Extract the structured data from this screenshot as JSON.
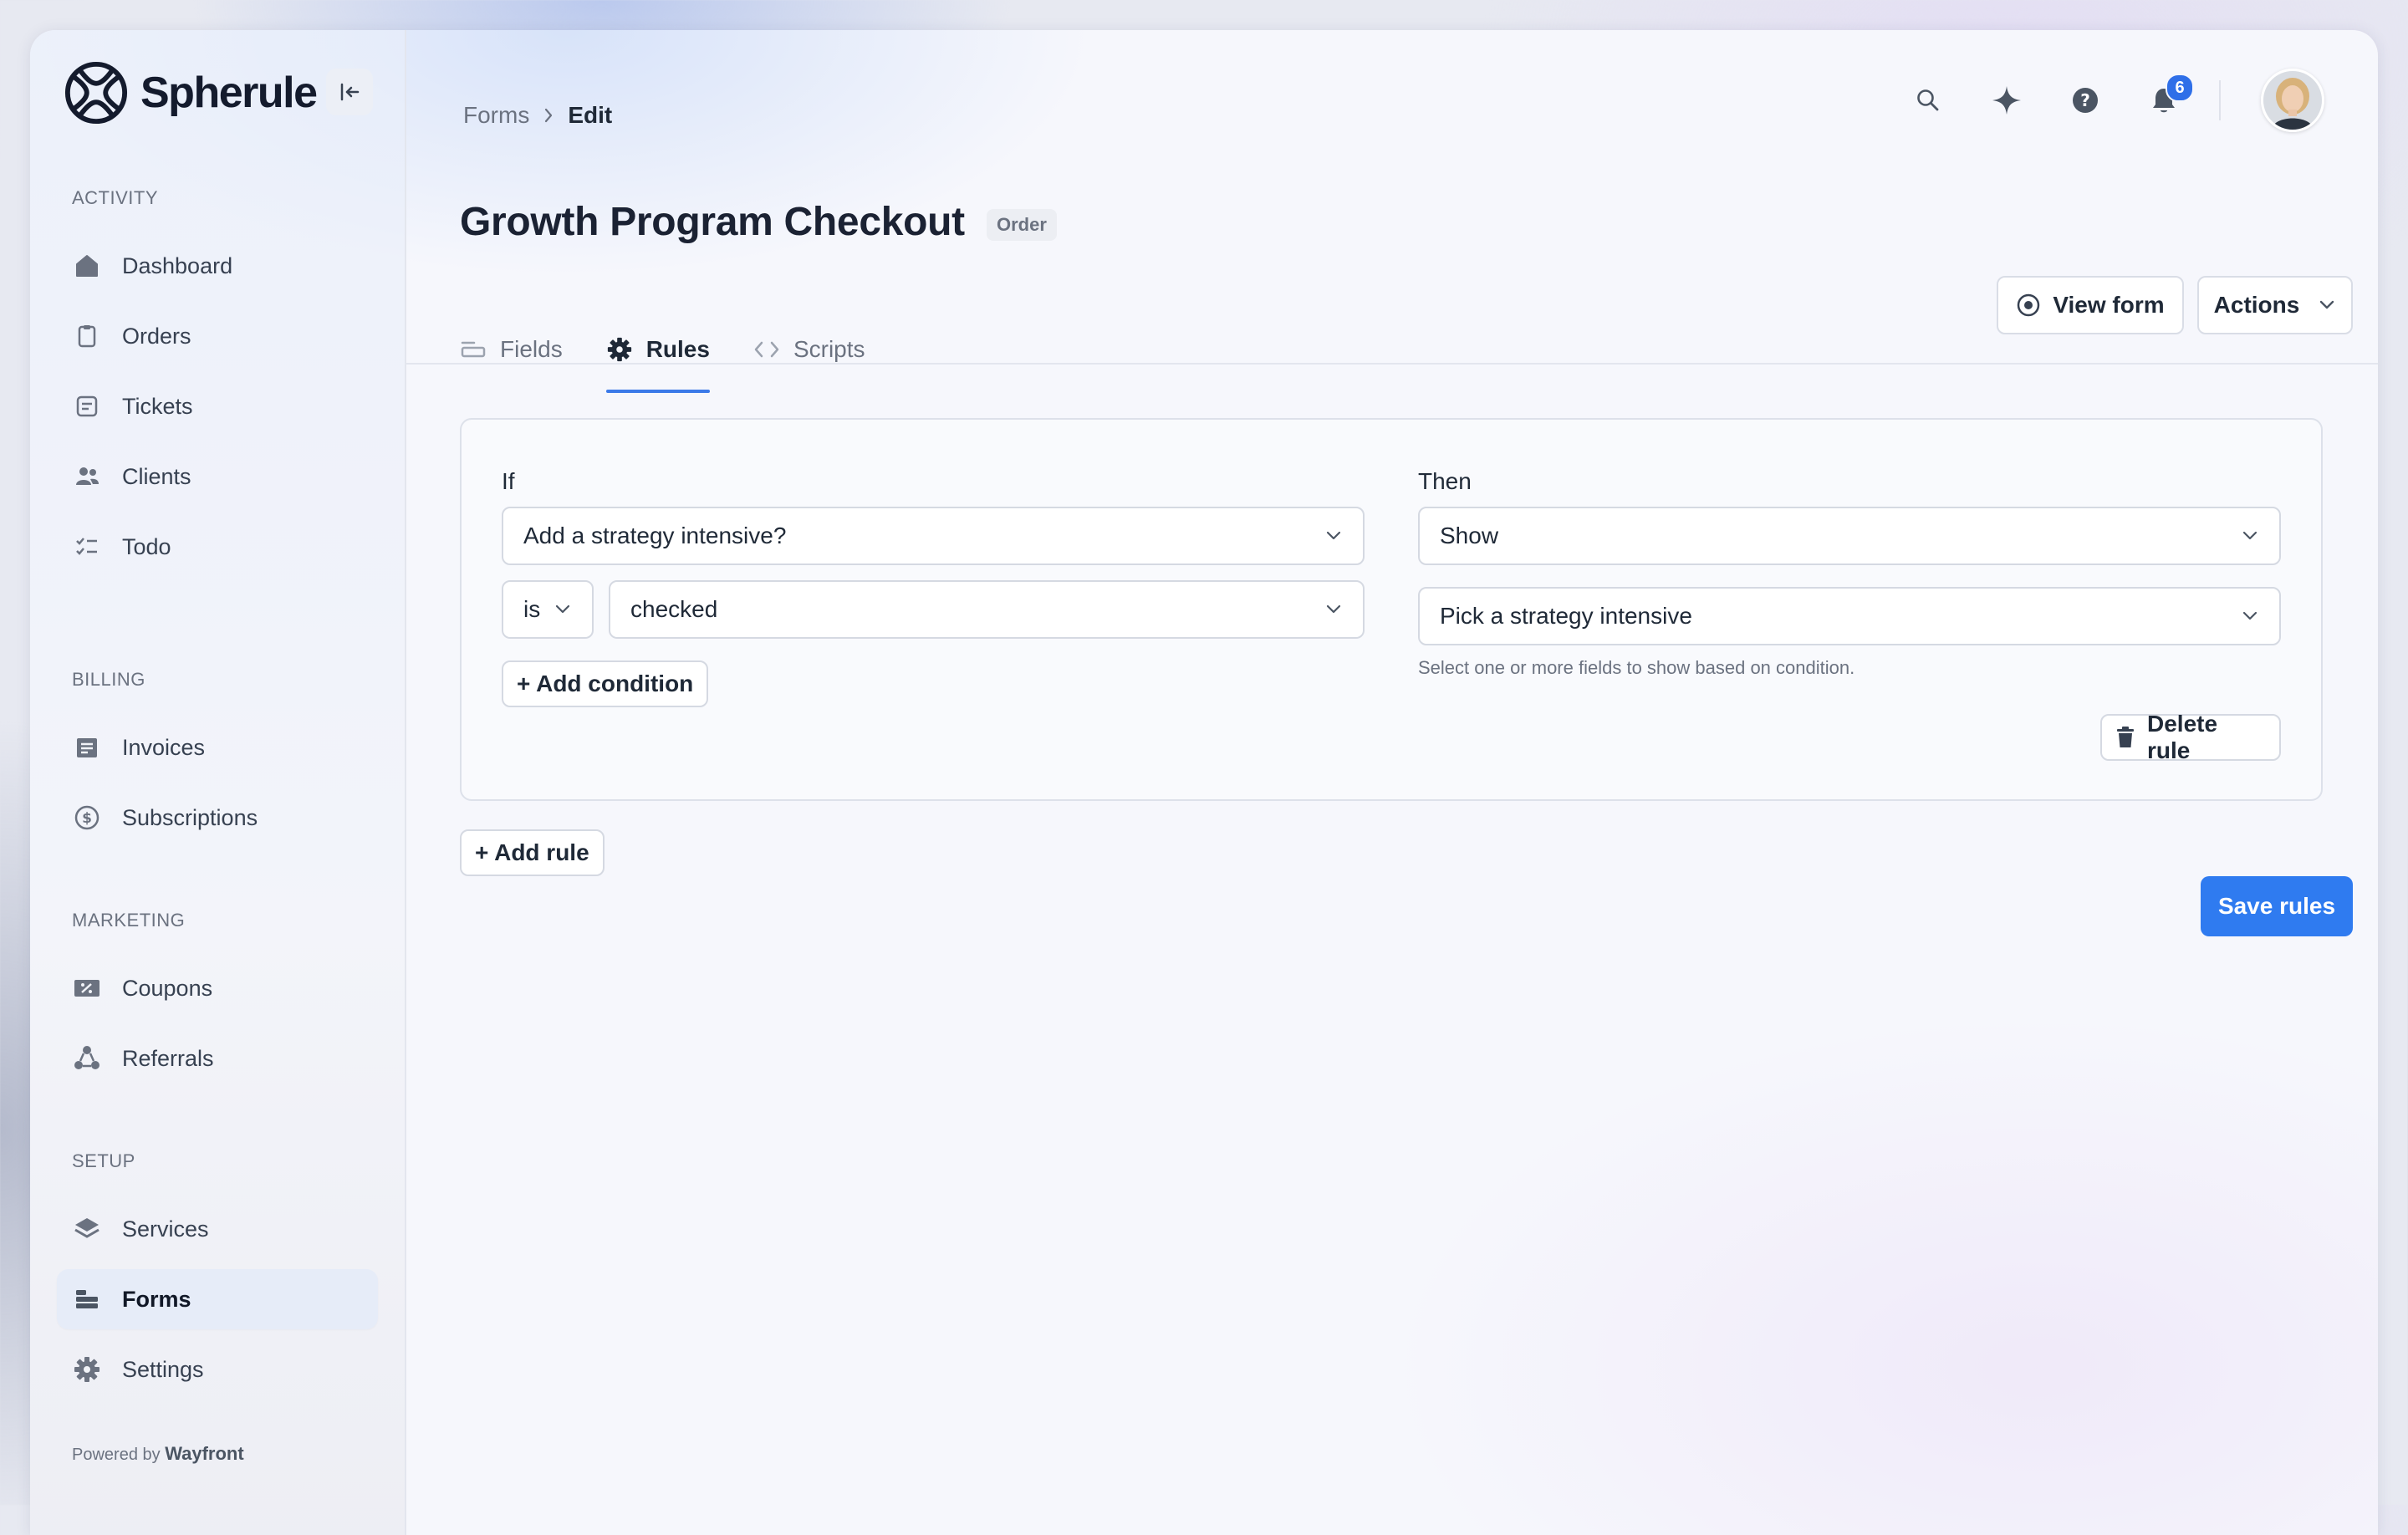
{
  "brand": {
    "name": "Spherule"
  },
  "sidebar": {
    "sections": [
      {
        "label": "Activity",
        "items": [
          {
            "label": "Dashboard",
            "icon": "home-icon"
          },
          {
            "label": "Orders",
            "icon": "clipboard-icon"
          },
          {
            "label": "Tickets",
            "icon": "ticket-icon"
          },
          {
            "label": "Clients",
            "icon": "users-icon"
          },
          {
            "label": "Todo",
            "icon": "checklist-icon"
          }
        ]
      },
      {
        "label": "Billing",
        "items": [
          {
            "label": "Invoices",
            "icon": "invoice-icon"
          },
          {
            "label": "Subscriptions",
            "icon": "dollar-cycle-icon"
          }
        ]
      },
      {
        "label": "Marketing",
        "items": [
          {
            "label": "Coupons",
            "icon": "coupon-icon"
          },
          {
            "label": "Referrals",
            "icon": "referral-icon"
          }
        ]
      },
      {
        "label": "Setup",
        "items": [
          {
            "label": "Services",
            "icon": "layers-icon"
          },
          {
            "label": "Forms",
            "icon": "forms-icon",
            "active": true
          },
          {
            "label": "Settings",
            "icon": "gear-icon"
          }
        ]
      }
    ],
    "powered_by": "Powered by",
    "powered_brand": "Wayfront"
  },
  "breadcrumb": {
    "parent": "Forms",
    "current": "Edit"
  },
  "header": {
    "notification_count": "6"
  },
  "page": {
    "title": "Growth Program Checkout",
    "badge": "Order",
    "tabs": [
      {
        "label": "Fields",
        "icon": "field-icon"
      },
      {
        "label": "Rules",
        "icon": "gear-icon",
        "active": true
      },
      {
        "label": "Scripts",
        "icon": "code-icon"
      }
    ],
    "view_form_label": "View form",
    "actions_label": "Actions"
  },
  "rule": {
    "if_label": "If",
    "then_label": "Then",
    "if_field": "Add a strategy intensive?",
    "operator": "is",
    "condition_value": "checked",
    "add_condition_label": "+ Add condition",
    "then_action": "Show",
    "then_target": "Pick a strategy intensive",
    "helper_text": "Select one or more fields to show based on condition.",
    "delete_label": "Delete rule"
  },
  "add_rule_label": "+ Add rule",
  "save_label": "Save rules",
  "colors": {
    "accent": "#2f7bf0",
    "badge": "#2f6fe8"
  }
}
